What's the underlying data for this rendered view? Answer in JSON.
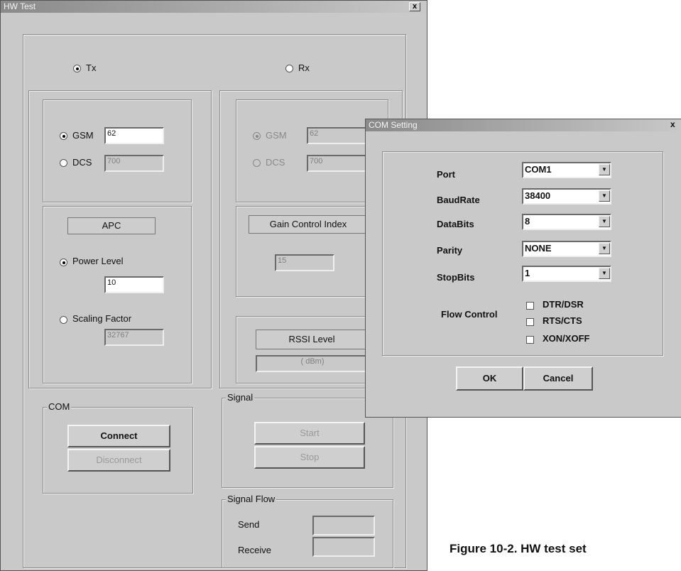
{
  "hw": {
    "title": "HW Test",
    "close": "x",
    "tx_label": "Tx",
    "rx_label": "Rx",
    "tx": {
      "gsm_label": "GSM",
      "gsm_value": "62",
      "dcs_label": "DCS",
      "dcs_value": "700",
      "apc_label": "APC",
      "power_label": "Power Level",
      "power_value": "10",
      "scaling_label": "Scaling Factor",
      "scaling_value": "32767"
    },
    "rx": {
      "gsm_label": "GSM",
      "gsm_value": "62",
      "dcs_label": "DCS",
      "dcs_value": "700",
      "gain_label": "Gain Control Index",
      "gain_value": "15",
      "rssi_label": "RSSI Level",
      "rssi_value": "(    dBm)"
    },
    "com": {
      "legend": "COM",
      "connect": "Connect",
      "disconnect": "Disconnect"
    },
    "signal": {
      "legend": "Signal",
      "start": "Start",
      "stop": "Stop"
    },
    "signal_flow": {
      "legend": "Signal Flow",
      "send": "Send",
      "receive": "Receive"
    }
  },
  "com_setting": {
    "title": "COM Setting",
    "close": "x",
    "port_label": "Port",
    "port_value": "COM1",
    "baud_label": "BaudRate",
    "baud_value": "38400",
    "databits_label": "DataBits",
    "databits_value": "8",
    "parity_label": "Parity",
    "parity_value": "NONE",
    "stopbits_label": "StopBits",
    "stopbits_value": "1",
    "flow_label": "Flow Control",
    "flow_options": [
      "DTR/DSR",
      "RTS/CTS",
      "XON/XOFF"
    ],
    "ok": "OK",
    "cancel": "Cancel"
  },
  "caption": "Figure 10-2. HW test set"
}
